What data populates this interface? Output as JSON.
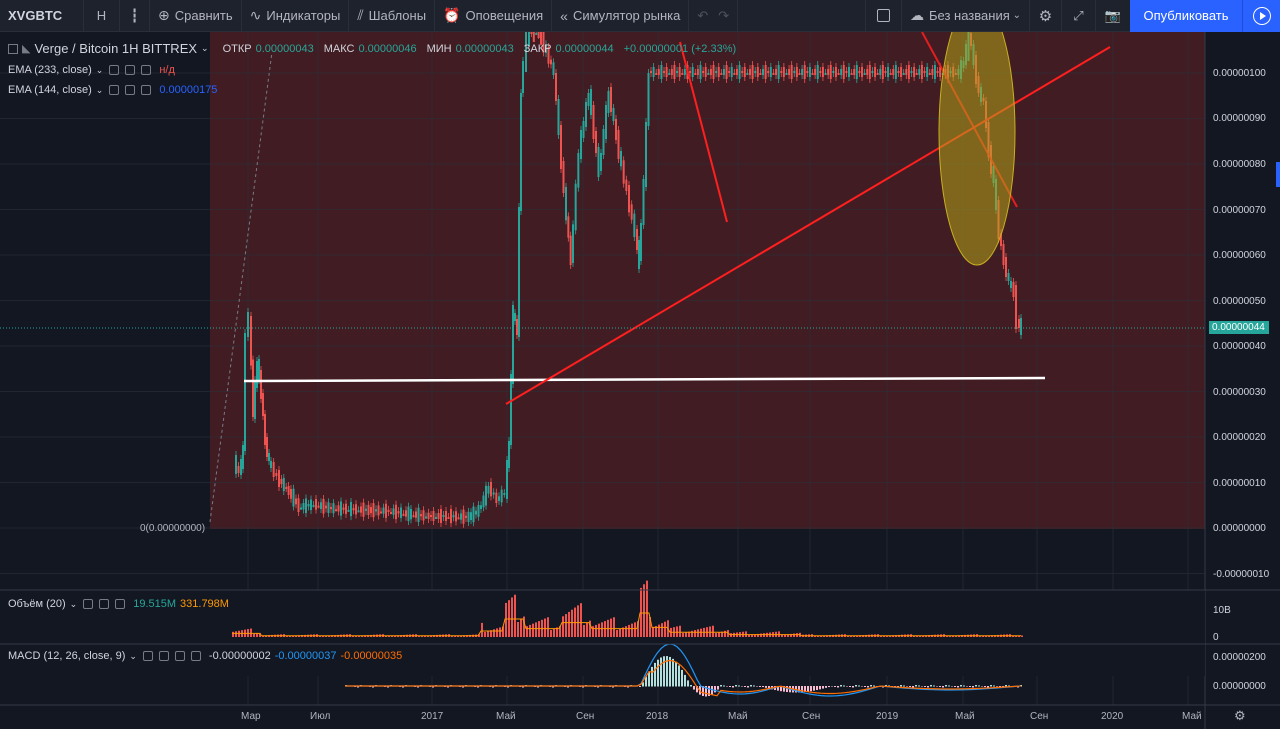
{
  "toolbar": {
    "symbol": "XVGBTC",
    "interval": "H",
    "compare": "Сравнить",
    "indicators": "Индикаторы",
    "templates": "Шаблоны",
    "alerts": "Оповещения",
    "replay": "Симулятор рынка",
    "layout_name": "Без названия",
    "publish": "Опубликовать"
  },
  "main_legend": {
    "title": "Verge / Bitcoin  1H  BITTREX",
    "open_label": "ОТКР",
    "open": "0.00000043",
    "high_label": "МАКС",
    "high": "0.00000046",
    "low_label": "МИН",
    "low": "0.00000043",
    "close_label": "ЗАКР",
    "close": "0.00000044",
    "change": "+0.00000001 (+2.33%)"
  },
  "ema233": {
    "label": "EMA (233, close)",
    "value": "н/д"
  },
  "ema144": {
    "label": "EMA (144, close)",
    "value": "0.00000175"
  },
  "volume": {
    "label": "Объём (20)",
    "value1": "19.515M",
    "value2": "331.798M"
  },
  "macd": {
    "label": "MACD (12, 26, close, 9)",
    "v1": "-0.00000002",
    "v2": "-0.00000037",
    "v3": "-0.00000035"
  },
  "price_axis": [
    "0.00000100",
    "0.00000090",
    "0.00000080",
    "0.00000070",
    "0.00000060",
    "0.00000050",
    "0.00000040",
    "0.00000030",
    "0.00000020",
    "0.00000010",
    "0.00000000",
    "-0.00000010"
  ],
  "current_price": "0.00000044",
  "zero_label": "0(0.00000000)",
  "volume_axis": [
    "10B",
    "0"
  ],
  "macd_axis": [
    "0.00000200",
    "0.00000000"
  ],
  "time_axis": [
    "Мар",
    "Июл",
    "2017",
    "Май",
    "Сен",
    "2018",
    "Май",
    "Сен",
    "2019",
    "Май",
    "Сен",
    "2020",
    "Май"
  ],
  "colors": {
    "up": "#26a69a",
    "down": "#ef5350",
    "bg": "#131722",
    "trend": "#ff1f1f",
    "support": "#ffffff"
  }
}
